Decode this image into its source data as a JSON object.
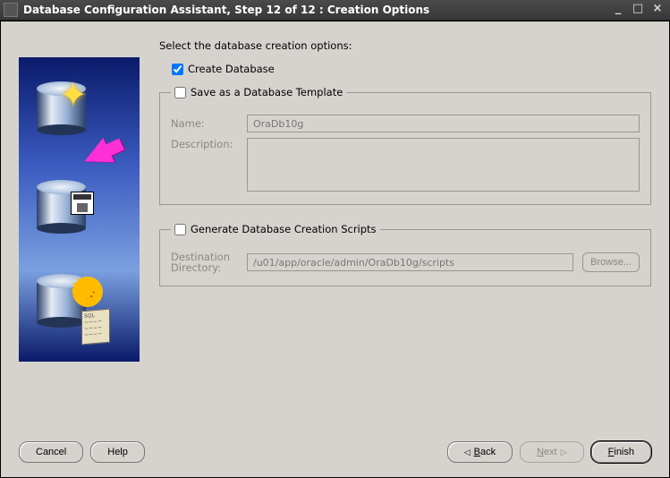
{
  "window": {
    "title": "Database Configuration Assistant, Step 12 of 12 : Creation Options"
  },
  "prompt": "Select the database creation options:",
  "options": {
    "create_database": {
      "label": "Create Database",
      "checked": true
    },
    "save_template": {
      "label": "Save as a Database Template",
      "checked": false
    },
    "gen_scripts": {
      "label": "Generate Database Creation Scripts",
      "checked": false
    }
  },
  "template_group": {
    "name_label": "Name:",
    "name_value": "OraDb10g",
    "desc_label": "Description:",
    "desc_value": ""
  },
  "scripts_group": {
    "dir_label": "Destination Directory:",
    "dir_value": "/u01/app/oracle/admin/OraDb10g/scripts",
    "browse_label": "Browse..."
  },
  "footer": {
    "cancel": "Cancel",
    "help": "Help",
    "back_pre": "B",
    "back_post": "ack",
    "next_pre": "N",
    "next_post": "ext",
    "finish_pre": "F",
    "finish_post": "inish"
  },
  "script_scribble": "SQL\n~~~~\n~~~~\n~~~~"
}
